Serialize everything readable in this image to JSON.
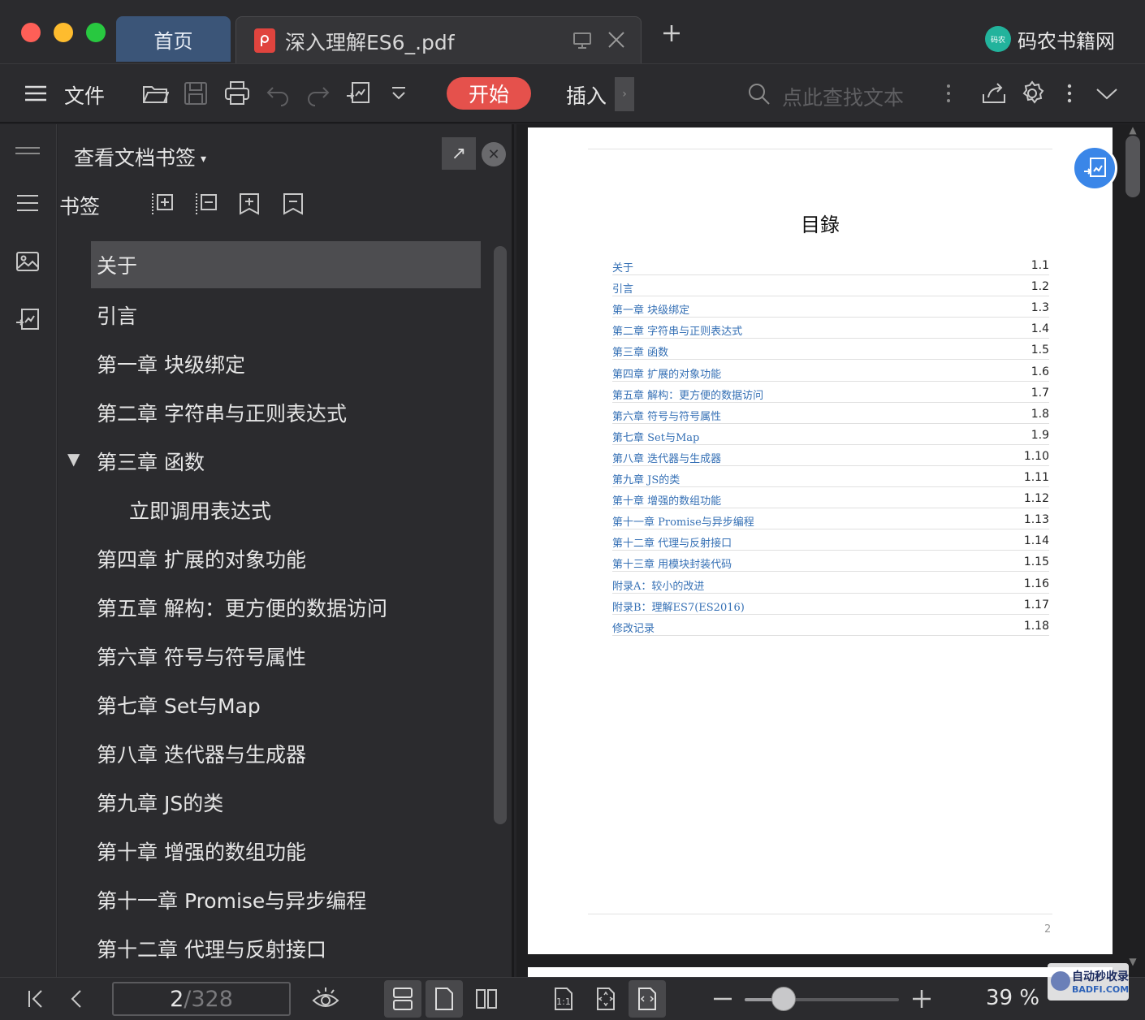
{
  "tabs": {
    "home_label": "首页",
    "file_label": "深入理解ES6_.pdf"
  },
  "brand": {
    "logo_text": "码农",
    "name": "码农书籍网"
  },
  "toolbar": {
    "file_label": "文件",
    "start_label": "开始",
    "insert_label": "插入",
    "more_label": "›",
    "search_placeholder": "点此查找文本"
  },
  "bookmark_panel": {
    "title": "查看文档书签",
    "caret": "▾",
    "pop_out": "↗",
    "close": "✕",
    "label": "书签",
    "items": [
      {
        "label": "关于"
      },
      {
        "label": "引言"
      },
      {
        "label": "第一章 块级绑定"
      },
      {
        "label": "第二章 字符串与正则表达式"
      },
      {
        "label": "第三章 函数",
        "toggle": "▼"
      },
      {
        "label": "立即调用表达式"
      },
      {
        "label": "第四章 扩展的对象功能"
      },
      {
        "label": "第五章 解构：更方便的数据访问"
      },
      {
        "label": "第六章 符号与符号属性"
      },
      {
        "label": "第七章 Set与Map"
      },
      {
        "label": "第八章 迭代器与生成器"
      },
      {
        "label": "第九章 JS的类"
      },
      {
        "label": "第十章 增强的数组功能"
      },
      {
        "label": "第十一章 Promise与异步编程"
      },
      {
        "label": "第十二章 代理与反射接口"
      }
    ]
  },
  "document": {
    "toc_title": "目錄",
    "page_number": "2",
    "toc": [
      {
        "name": "关于",
        "num": "1.1"
      },
      {
        "name": "引言",
        "num": "1.2"
      },
      {
        "name": "第一章 块级绑定",
        "num": "1.3"
      },
      {
        "name": "第二章 字符串与正则表达式",
        "num": "1.4"
      },
      {
        "name": "第三章 函数",
        "num": "1.5"
      },
      {
        "name": "第四章 扩展的对象功能",
        "num": "1.6"
      },
      {
        "name": "第五章 解构：更方便的数据访问",
        "num": "1.7"
      },
      {
        "name": "第六章 符号与符号属性",
        "num": "1.8"
      },
      {
        "name": "第七章 Set与Map",
        "num": "1.9"
      },
      {
        "name": "第八章 迭代器与生成器",
        "num": "1.10"
      },
      {
        "name": "第九章 JS的类",
        "num": "1.11"
      },
      {
        "name": "第十章 增强的数组功能",
        "num": "1.12"
      },
      {
        "name": "第十一章 Promise与异步编程",
        "num": "1.13"
      },
      {
        "name": "第十二章 代理与反射接口",
        "num": "1.14"
      },
      {
        "name": "第十三章 用模块封装代码",
        "num": "1.15"
      },
      {
        "name": "附录A：较小的改进",
        "num": "1.16"
      },
      {
        "name": "附录B：理解ES7(ES2016)",
        "num": "1.17"
      },
      {
        "name": "修改记录",
        "num": "1.18"
      }
    ]
  },
  "status": {
    "current_page": "2",
    "total_pages": "/328",
    "zoom_label": "39 %",
    "zoom_fraction": 0.25
  },
  "watermark": {
    "top": "自动秒收录",
    "bottom": "BADFI.COM"
  }
}
